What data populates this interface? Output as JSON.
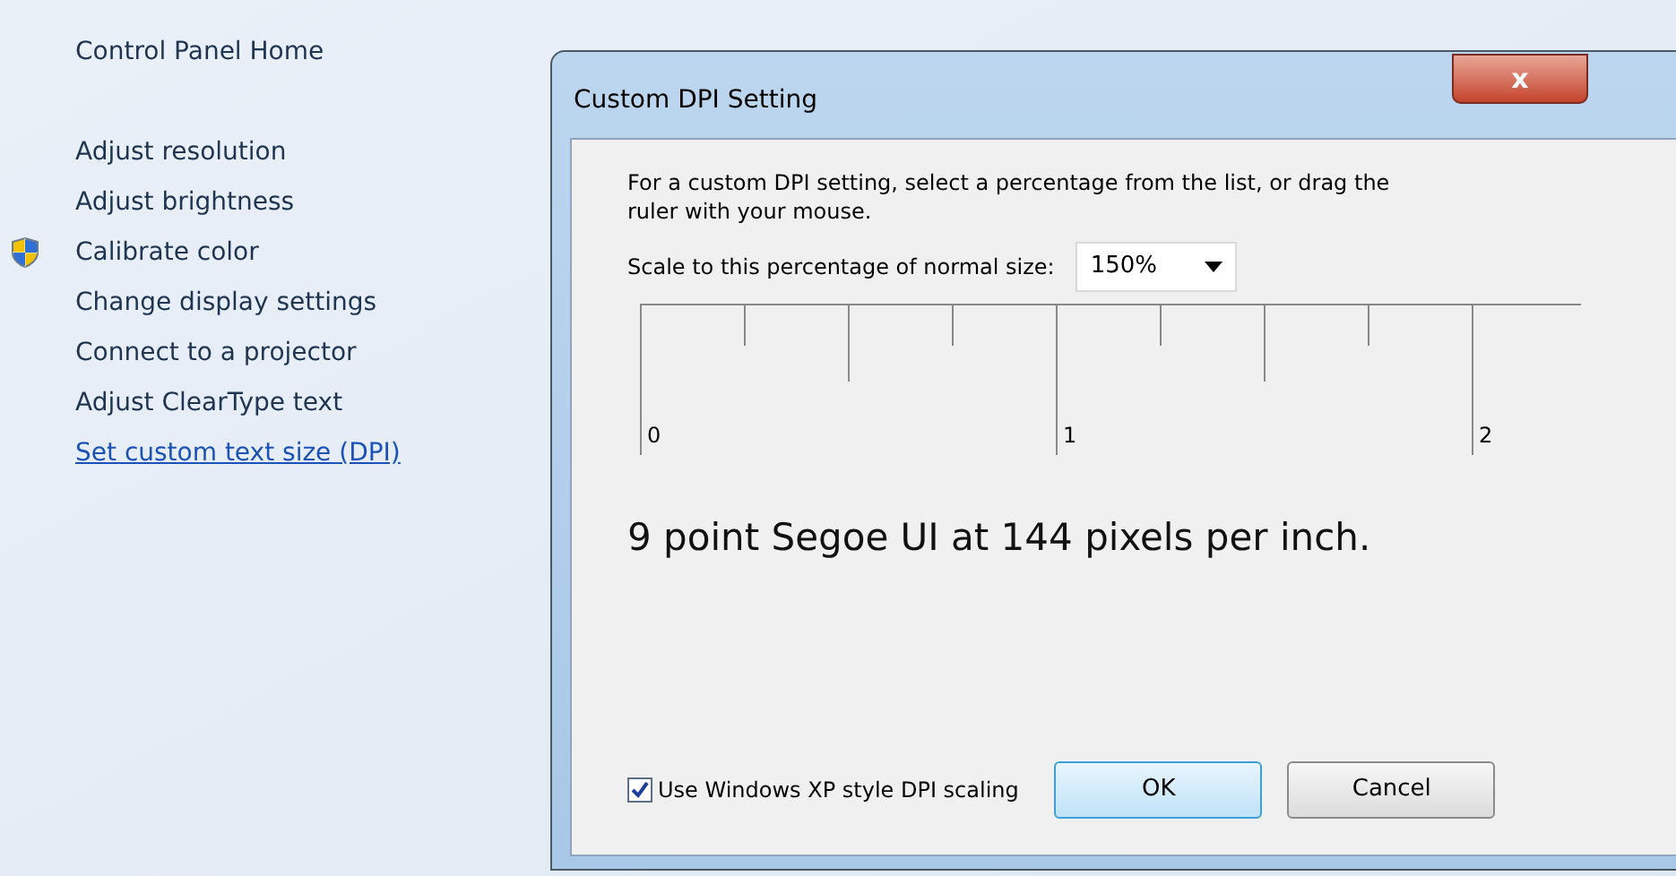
{
  "sidebar": {
    "items": [
      {
        "label": "Control Panel Home",
        "kind": "text"
      },
      {
        "label": "Adjust resolution",
        "kind": "text"
      },
      {
        "label": "Adjust brightness",
        "kind": "text"
      },
      {
        "label": "Calibrate color",
        "kind": "shield"
      },
      {
        "label": "Change display settings",
        "kind": "text"
      },
      {
        "label": "Connect to a projector",
        "kind": "text"
      },
      {
        "label": "Adjust ClearType text",
        "kind": "text"
      },
      {
        "label": "Set custom text size (DPI)",
        "kind": "link"
      }
    ]
  },
  "dialog": {
    "title": "Custom DPI Setting",
    "close": "x",
    "intro": "For a custom DPI setting, select a percentage from the list, or drag the ruler with your mouse.",
    "scale_label": "Scale to this percentage of normal size:",
    "scale_value": "150%",
    "ruler_labels": [
      "0",
      "1",
      "2"
    ],
    "preview": "9 point Segoe UI at 144 pixels per inch.",
    "checkbox": {
      "label": "Use Windows XP style DPI scaling",
      "checked": true
    },
    "buttons": [
      {
        "label": "OK",
        "kind": "default"
      },
      {
        "label": "Cancel",
        "kind": "normal"
      }
    ]
  }
}
